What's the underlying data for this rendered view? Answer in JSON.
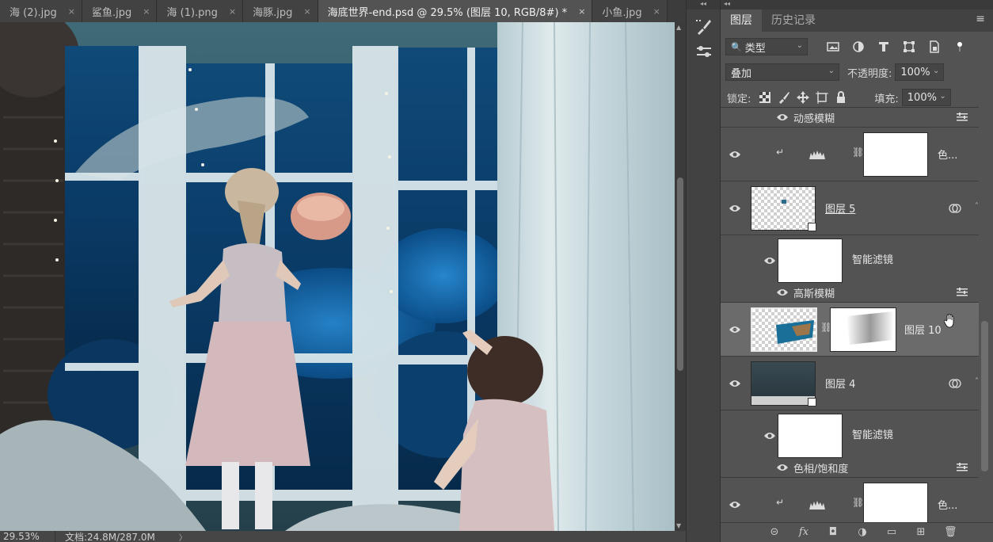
{
  "tabs": [
    {
      "label": "海 (2).jpg",
      "close": "×"
    },
    {
      "label": "鲨鱼.jpg",
      "close": "×"
    },
    {
      "label": "海 (1).png",
      "close": "×"
    },
    {
      "label": "海豚.jpg",
      "close": "×"
    },
    {
      "label": "海底世界-end.psd @ 29.5% (图层 10, RGB/8#) *",
      "close": "×"
    },
    {
      "label": "小鱼.jpg",
      "close": "×"
    }
  ],
  "active_tab_index": 4,
  "status": {
    "zoom": "29.53%",
    "doc_info": "文档:24.8M/287.0M",
    "arrow": "〉"
  },
  "panel": {
    "tabs": [
      "图层",
      "历史记录"
    ],
    "active_tab": "图层",
    "menu_icon": "panel-menu-icon",
    "filter": {
      "label": "类型",
      "icons": [
        "image-filter-icon",
        "adjustment-filter-icon",
        "type-filter-icon",
        "shape-filter-icon",
        "smart-object-filter-icon",
        "filter-toggle-icon"
      ]
    },
    "blend_mode": "叠加",
    "opacity_label": "不透明度:",
    "opacity_value": "100%",
    "lock_label": "锁定:",
    "lock_icons": [
      "lock-transparent-icon",
      "lock-paint-icon",
      "lock-position-icon",
      "lock-artboard-icon",
      "lock-all-icon"
    ],
    "fill_label": "填充:",
    "fill_value": "100%"
  },
  "layers": {
    "motion_blur": "动感模糊",
    "adjust_top": "色...",
    "layer5": "图层 5",
    "smart_filter_1": "智能滤镜",
    "gaussian_blur": "高斯模糊",
    "layer10": "图层 10",
    "layer4": "图层 4",
    "smart_filter_2": "智能滤镜",
    "hue_sat": "色相/饱和度",
    "adjust_bottom": "色..."
  },
  "bottom_icons": [
    "link-layers-icon",
    "fx-icon",
    "add-mask-icon",
    "new-adjustment-icon",
    "new-group-icon",
    "new-layer-icon",
    "delete-layer-icon"
  ],
  "bottom_glyphs": [
    "⊝",
    "fx",
    "◘",
    "◑",
    "▭",
    "⊞",
    "🗑"
  ]
}
